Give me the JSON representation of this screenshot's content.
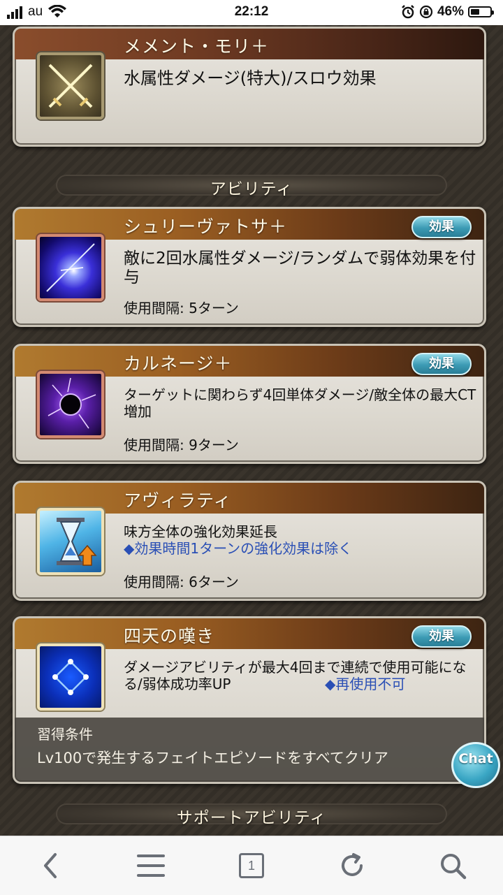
{
  "status_bar": {
    "carrier": "au",
    "time": "22:12",
    "battery": "46%",
    "battery_level": 0.46
  },
  "weapon": {
    "name": "メメント・モリ＋",
    "description": "水属性ダメージ(特大)/スロウ効果",
    "icon": "crossed-swords-icon"
  },
  "sections": {
    "abilities": "アビリティ",
    "support_abilities": "サポートアビリティ"
  },
  "abilities": [
    {
      "name": "シュリーヴァトサ＋",
      "effect_button": "効果",
      "description": "敵に2回水属性ダメージ/ランダムで弱体効果を付与",
      "interval": "使用間隔: 5ターン",
      "icon": "water-flash-icon"
    },
    {
      "name": "カルネージ＋",
      "effect_button": "効果",
      "description": "ターゲットに関わらず4回単体ダメージ/敵全体の最大CT増加",
      "interval": "使用間隔: 9ターン",
      "icon": "dark-orb-icon"
    },
    {
      "name": "アヴィラティ",
      "description": "味方全体の強化効果延長",
      "note": "◆効果時間1ターンの強化効果は除く",
      "interval": "使用間隔: 6ターン",
      "icon": "hourglass-up-icon"
    },
    {
      "name": "四天の嘆き",
      "effect_button": "効果",
      "description": "ダメージアビリティが最大4回まで連続で使用可能になる/弱体成功率UP",
      "note": "◆再使用不可",
      "icon": "constellation-icon",
      "acquire_title": "習得条件",
      "acquire_text": "Lv100で発生するフェイトエピソードをすべてクリア"
    }
  ],
  "chat_button": {
    "label": "Chat"
  },
  "toolbar": {
    "back_icon": "chevron-left-icon",
    "menu_icon": "menu-icon",
    "tabs_count": "1",
    "reload_icon": "reload-icon",
    "search_icon": "search-icon"
  }
}
